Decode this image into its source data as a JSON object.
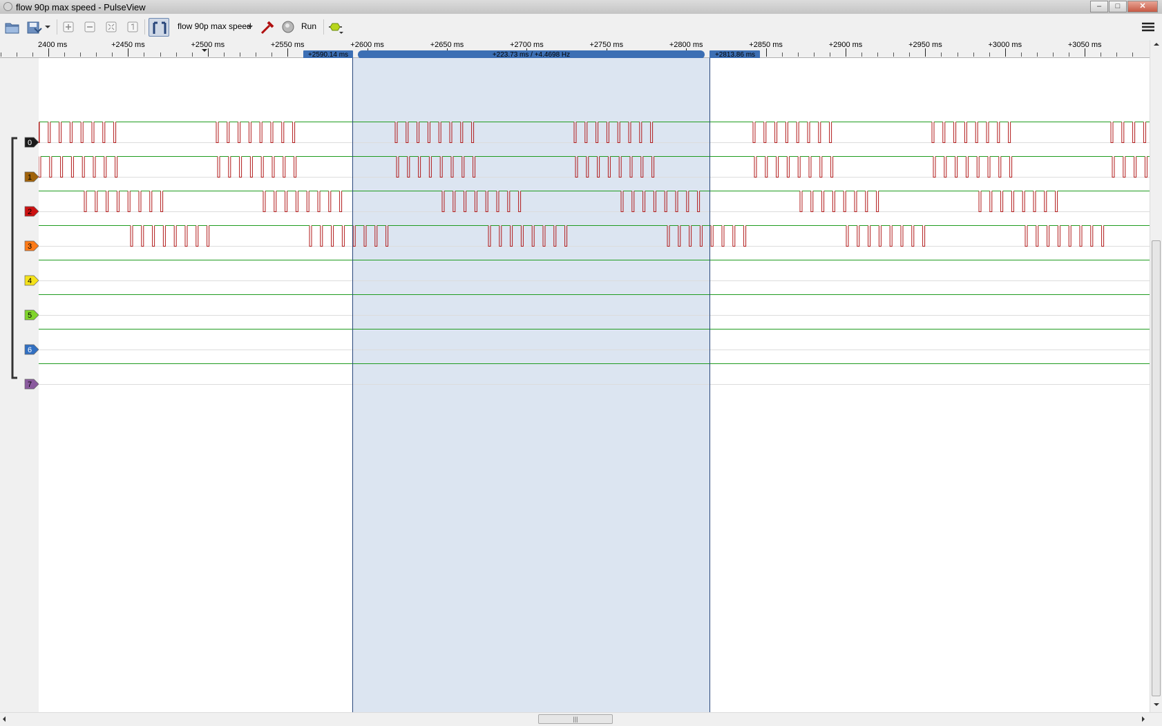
{
  "window": {
    "title": "flow 90p max speed - PulseView",
    "controls": [
      "–",
      "□",
      "✕"
    ]
  },
  "toolbar": {
    "device": "flow 90p max speed",
    "run_label": "Run"
  },
  "ruler": {
    "ticks": [
      "2400 ms",
      "+2450 ms",
      "+2500 ms",
      "+2550 ms",
      "+2600 ms",
      "+2650 ms",
      "+2700 ms",
      "+2750 ms",
      "+2800 ms",
      "+2850 ms",
      "+2900 ms",
      "+2950 ms",
      "+3000 ms",
      "+3050 ms"
    ],
    "cursor_a": "+2590.14 ms",
    "cursor_b": "+2813.86 ms",
    "cursor_span": "+223.73 ms / +4.4698 Hz"
  },
  "channels": [
    {
      "label": "0",
      "color": "#1a1a1a"
    },
    {
      "label": "1",
      "color": "#a0620a"
    },
    {
      "label": "2",
      "color": "#cc1111"
    },
    {
      "label": "3",
      "color": "#ff7b17"
    },
    {
      "label": "4",
      "color": "#f4e21a"
    },
    {
      "label": "5",
      "color": "#7fd42b"
    },
    {
      "label": "6",
      "color": "#3270c2"
    },
    {
      "label": "7",
      "color": "#8a5a9e"
    }
  ],
  "colors": {
    "signal_high": "#1e9b1e",
    "signal_low": "#b01818",
    "cursor_region": "#dce5f1",
    "cursor_flag": "#3c6fb4"
  }
}
